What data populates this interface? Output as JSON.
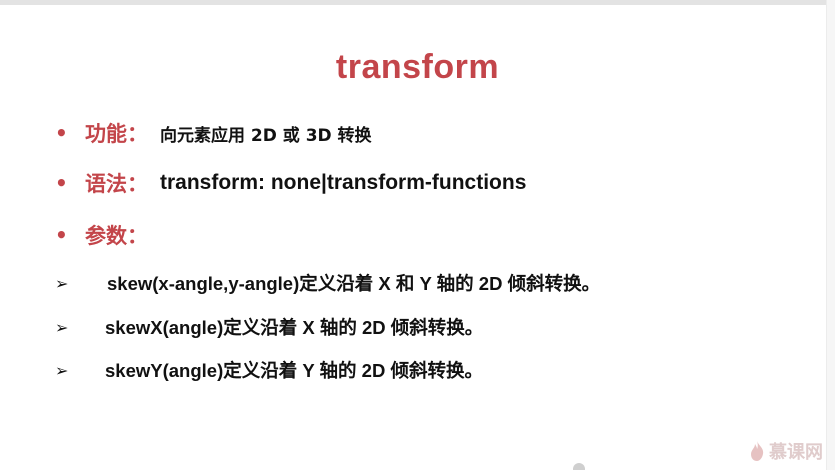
{
  "title": "transform",
  "bullets": [
    {
      "label": "功能：",
      "value": "向元素应用 2D 或 3D 转换"
    },
    {
      "label": "语法：",
      "value": "transform: none|transform-functions"
    },
    {
      "label": "参数：",
      "value": ""
    }
  ],
  "params": [
    "skew(x-angle,y-angle)定义沿着 X 和 Y 轴的 2D 倾斜转换。",
    "skewX(angle)定义沿着 X 轴的 2D 倾斜转换。",
    "skewY(angle)定义沿着 Y 轴的 2D 倾斜转换。"
  ],
  "bullet_symbol": "•",
  "arrow_symbol": "➢",
  "watermark": "慕课网",
  "colors": {
    "accent": "#c3454a",
    "text": "#111111"
  }
}
